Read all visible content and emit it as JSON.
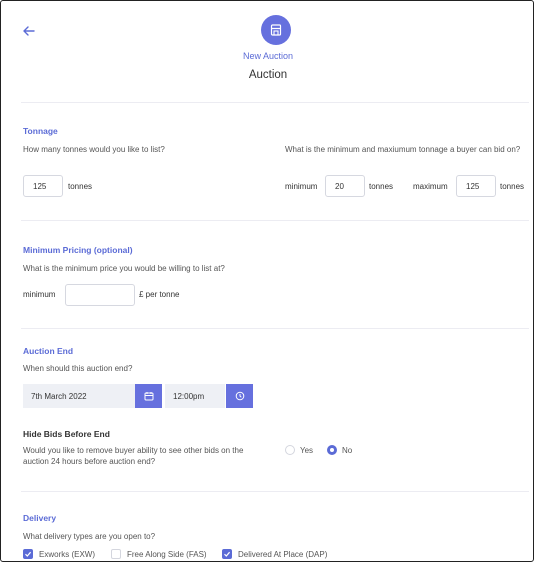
{
  "header": {
    "back_icon": "arrow-left-icon",
    "badge_icon": "storefront-icon",
    "subtitle": "New Auction",
    "title": "Auction"
  },
  "tonnage": {
    "title": "Tonnage",
    "list_question": "How many tonnes would you like to list?",
    "list_value": "125",
    "list_unit": "tonnes",
    "range_question": "What is the minimum and maxiumum tonnage a buyer can bid on?",
    "min_label": "minimum",
    "min_value": "20",
    "min_unit": "tonnes",
    "max_label": "maximum",
    "max_value": "125",
    "max_unit": "tonnes"
  },
  "pricing": {
    "title": "Minimum Pricing (optional)",
    "question": "What is the minimum price you would be willing to list at?",
    "min_label": "minimum",
    "min_value": "",
    "unit": "£ per tonne"
  },
  "auction_end": {
    "title": "Auction End",
    "question": "When should this auction end?",
    "date": "7th March 2022",
    "time": "12:00pm",
    "calendar_icon": "calendar-icon",
    "clock_icon": "clock-icon"
  },
  "hide_bids": {
    "title": "Hide Bids Before End",
    "question": "Would you like to remove buyer ability to see other bids on the auction 24 hours before auction end?",
    "options": [
      {
        "label": "Yes",
        "selected": false
      },
      {
        "label": "No",
        "selected": true
      }
    ]
  },
  "delivery": {
    "title": "Delivery",
    "question": "What delivery types are you open to?",
    "options": [
      {
        "label": "Exworks (EXW)",
        "checked": true
      },
      {
        "label": "Free Along Side (FAS)",
        "checked": false
      },
      {
        "label": "Delivered At Place (DAP)",
        "checked": true
      }
    ]
  },
  "colors": {
    "accent": "#6670de",
    "accent_text": "#5b6bd6",
    "field_bg": "#eef0f5",
    "border": "#d6d8e0"
  }
}
